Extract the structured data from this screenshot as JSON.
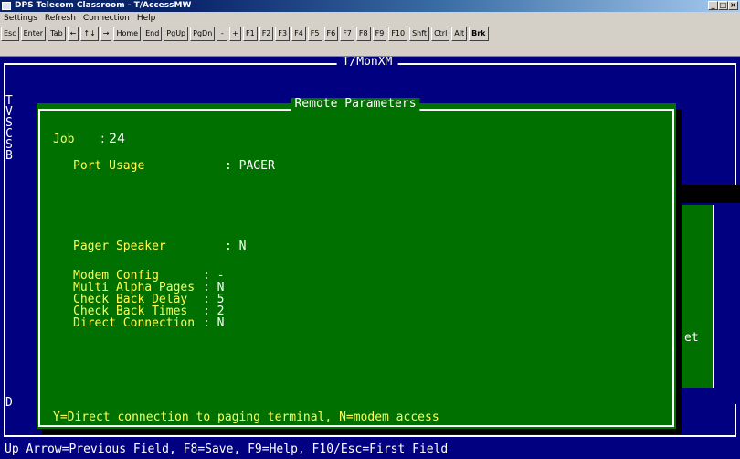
{
  "window": {
    "title": "DPS Telecom Classroom - T/AccessMW"
  },
  "menu": [
    "Settings",
    "Refresh",
    "Connection",
    "Help"
  ],
  "toolbar_keys": [
    "Esc",
    "Enter",
    "Tab",
    "←",
    "↑↓",
    "→",
    "Home",
    "End",
    "PgUp",
    "PgDn",
    "-",
    "+",
    "F1",
    "F2",
    "F3",
    "F4",
    "F5",
    "F6",
    "F7",
    "F8",
    "F9",
    "F10",
    "Shft",
    "Ctrl",
    "Alt",
    "Brk"
  ],
  "terminal": {
    "screen_title": "T/MonXM",
    "left_letters": [
      "T",
      "V",
      "S",
      "C",
      "S",
      "B"
    ],
    "bottom_left_letter": "D",
    "right_fragment": "et",
    "status_line": "Up Arrow=Previous Field, F8=Save, F9=Help, F10/Esc=First Field"
  },
  "dialog": {
    "title": "Remote Parameters",
    "job_label": "Job",
    "job_value": ": 24",
    "port_usage_label": "Port Usage",
    "port_usage_value": ": PAGER",
    "pager_speaker_label": "Pager Speaker",
    "pager_speaker_value": ": N",
    "fields": [
      {
        "label": "Modem Config     ",
        "value": ": -"
      },
      {
        "label": "Multi Alpha Pages",
        "value": ": N"
      },
      {
        "label": "Check Back Delay ",
        "value": ": 5"
      },
      {
        "label": "Check Back Times ",
        "value": ": 2"
      },
      {
        "label": "Direct Connection",
        "value": ": N"
      }
    ],
    "hint": "Y=Direct connection to paging terminal, N=modem access"
  },
  "colors": {
    "terminal_bg": "#000080",
    "dialog_bg": "#007000",
    "label_color": "#ffff55",
    "value_color": "#ffffff",
    "chrome": "#d4d0c8"
  }
}
